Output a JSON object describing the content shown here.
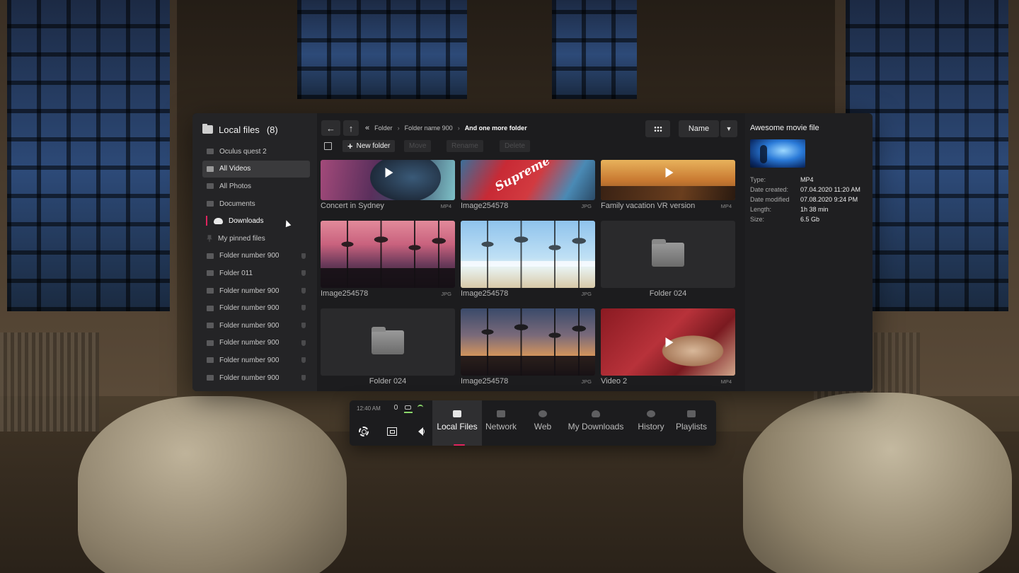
{
  "colors": {
    "accent": "#e0245e",
    "panel": "#1c1c1e",
    "sidebar": "#242426",
    "status_ok": "#8ad66a"
  },
  "sidebar": {
    "title": "Local files",
    "count": "(8)",
    "items": [
      {
        "label": "Oculus quest 2",
        "icon": "headset-icon"
      },
      {
        "label": "All Videos",
        "icon": "video-icon",
        "active": true
      },
      {
        "label": "All Photos",
        "icon": "photo-icon"
      },
      {
        "label": "Documents",
        "icon": "document-icon"
      },
      {
        "label": "Downloads",
        "icon": "cloud-download-icon"
      },
      {
        "label": "My pinned files",
        "icon": "pin-icon"
      },
      {
        "label": "Folder number 900",
        "icon": "folder-icon"
      },
      {
        "label": "Folder 011",
        "icon": "folder-icon"
      },
      {
        "label": "Folder number 900",
        "icon": "folder-icon"
      },
      {
        "label": "Folder number 900",
        "icon": "folder-icon"
      },
      {
        "label": "Folder number 900",
        "icon": "folder-icon"
      },
      {
        "label": "Folder number 900",
        "icon": "folder-icon"
      },
      {
        "label": "Folder number 900",
        "icon": "folder-icon"
      },
      {
        "label": "Folder number 900",
        "icon": "folder-icon"
      }
    ]
  },
  "toolbar": {
    "back_icon": "←",
    "up_icon": "↑",
    "breadcrumb_root_icon": "«",
    "breadcrumb": [
      "Folder",
      "Folder name 900",
      "And one more folder"
    ],
    "breadcrumb_sep": "›",
    "sort_label": "Name",
    "sort_dropdown_icon": "▼",
    "new_folder_label": "New folder",
    "new_folder_icon": "+",
    "move_label": "Move",
    "rename_label": "Rename",
    "delete_label": "Delete"
  },
  "files": [
    {
      "name": "Concert in Sydney",
      "format": "MP4",
      "kind": "video"
    },
    {
      "name": "Image254578",
      "format": "JPG",
      "kind": "image",
      "art_text": "Supreme"
    },
    {
      "name": "Family vacation VR version",
      "format": "MP4",
      "kind": "video"
    },
    {
      "name": "Image254578",
      "format": "JPG",
      "kind": "image"
    },
    {
      "name": "Image254578",
      "format": "JPG",
      "kind": "image"
    },
    {
      "name": "Folder 024",
      "format": "",
      "kind": "folder"
    },
    {
      "name": "Folder 024",
      "format": "",
      "kind": "folder"
    },
    {
      "name": "Image254578",
      "format": "JPG",
      "kind": "image"
    },
    {
      "name": "Video 2",
      "format": "MP4",
      "kind": "video"
    }
  ],
  "details": {
    "title": "Awesome movie file",
    "rows": [
      {
        "key": "Type:",
        "value": "MP4"
      },
      {
        "key": "Date created:",
        "value": "07.04.2020 11:20 AM"
      },
      {
        "key": "Date modified",
        "value": "07.08.2020 9:24 PM"
      },
      {
        "key": "Length:",
        "value": "1h 38 min"
      },
      {
        "key": "Size:",
        "value": "6.5 Gb"
      }
    ]
  },
  "dock": {
    "time": "12:40 AM",
    "tabs": [
      {
        "label": "Local Files",
        "icon": "local-files-icon",
        "active": true
      },
      {
        "label": "Network",
        "icon": "network-icon"
      },
      {
        "label": "Web",
        "icon": "globe-icon"
      },
      {
        "label": "My Downloads",
        "icon": "cloud-download-icon"
      },
      {
        "label": "History",
        "icon": "history-icon"
      },
      {
        "label": "Playlists",
        "icon": "playlist-icon"
      }
    ]
  }
}
